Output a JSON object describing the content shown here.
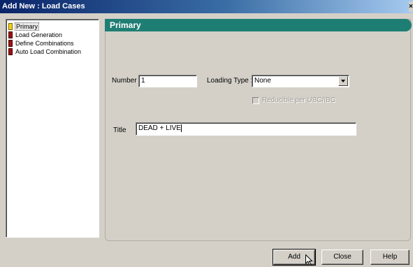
{
  "window": {
    "title": "Add New : Load Cases"
  },
  "tree": {
    "items": [
      {
        "label": "Primary",
        "icon": "book-yellow-icon"
      },
      {
        "label": "Load Generation",
        "icon": "book-red-icon"
      },
      {
        "label": "Define Combinations",
        "icon": "book-red-icon"
      },
      {
        "label": "Auto Load Combination",
        "icon": "book-red-icon"
      }
    ]
  },
  "panel": {
    "header": "Primary",
    "number_label": "Number",
    "number_value": "1",
    "loading_type_label": "Loading Type :",
    "loading_type_value": "None",
    "reducible_label": "Reducible per UBC/IBC",
    "title_label": "Title",
    "title_value": "DEAD + LIVE"
  },
  "buttons": {
    "add": "Add",
    "close": "Close",
    "help": "Help"
  },
  "colors": {
    "panel_header": "#1f7e74",
    "dialog_bg": "#d4d0c8"
  }
}
